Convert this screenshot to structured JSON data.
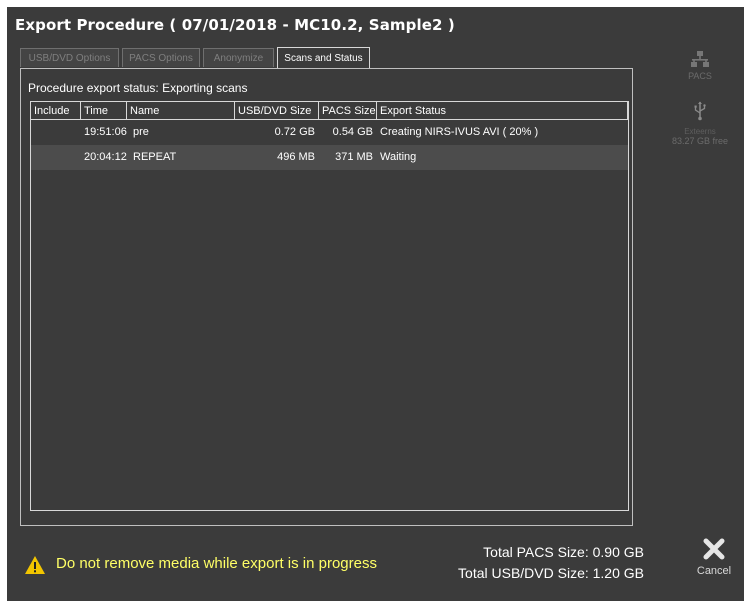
{
  "dialog": {
    "title": "Export Procedure  ( 07/01/2018 - MC10.2, Sample2 )"
  },
  "tabs": [
    {
      "label": "USB/DVD Options",
      "active": false
    },
    {
      "label": "PACS Options",
      "active": false
    },
    {
      "label": "Anonymize",
      "active": false
    },
    {
      "label": "Scans and Status",
      "active": true
    }
  ],
  "status": {
    "text": "Procedure export status: Exporting scans"
  },
  "table": {
    "columns": [
      "Include",
      "Time",
      "Name",
      "USB/DVD Size",
      "PACS Size",
      "Export Status"
    ],
    "rows": [
      {
        "include": "",
        "time": "19:51:06",
        "name": "pre",
        "usb_size": "0.72 GB",
        "pacs_size": "0.54 GB",
        "status": "Creating NIRS-IVUS AVI ( 20% )"
      },
      {
        "include": "",
        "time": "20:04:12",
        "name": "REPEAT",
        "usb_size": "496 MB",
        "pacs_size": "371 MB",
        "status": "Waiting"
      }
    ]
  },
  "side": {
    "pacs_label": "PACS",
    "usb_label": "Exteerns",
    "usb_free": "83.27 GB free",
    "pacs_icon": "network-icon",
    "usb_icon": "usb-icon"
  },
  "footer": {
    "warning": "Do not remove media while export is in progress",
    "total_pacs": "Total PACS Size: 0.90 GB",
    "total_usb": "Total USB/DVD Size: 1.20 GB",
    "cancel_label": "Cancel"
  },
  "colors": {
    "background": "#3b3b3b",
    "warning_text": "#ffff66",
    "warning_icon": "#f2c500"
  }
}
